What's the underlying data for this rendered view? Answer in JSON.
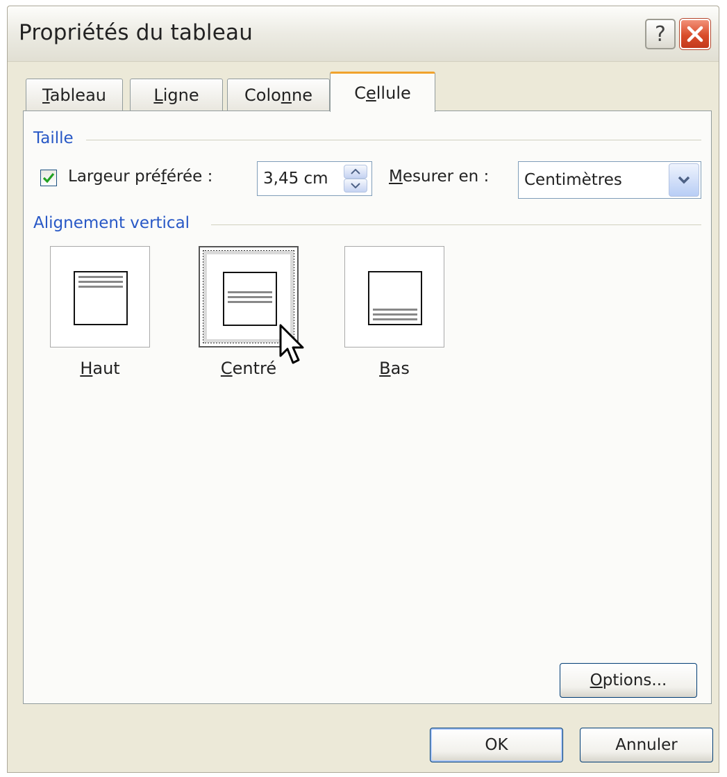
{
  "dialog": {
    "title": "Propriétés du tableau",
    "help_symbol": "?",
    "close_icon": "close-icon"
  },
  "tabs": [
    {
      "pre": "",
      "u": "T",
      "post": "ableau",
      "active": false
    },
    {
      "pre": "",
      "u": "L",
      "post": "igne",
      "active": false
    },
    {
      "pre": "Colo",
      "u": "n",
      "post": "ne",
      "active": false
    },
    {
      "pre": "C",
      "u": "e",
      "post": "llule",
      "active": true
    }
  ],
  "size_section": {
    "label": "Taille",
    "preferred_width": {
      "checked": true,
      "label_pre": "Largeur pré",
      "label_u": "f",
      "label_post": "érée :",
      "value": "3,45 cm"
    },
    "measure_in": {
      "label_u": "M",
      "label_post": "esurer en :",
      "selected": "Centimètres"
    }
  },
  "vertical_alignment": {
    "label": "Alignement vertical",
    "options": [
      {
        "u": "H",
        "post": "aut",
        "position": "top",
        "selected": false
      },
      {
        "u": "C",
        "post": "entré",
        "position": "center",
        "selected": true
      },
      {
        "u": "B",
        "post": "as",
        "position": "bottom",
        "selected": false
      }
    ]
  },
  "buttons": {
    "options_u": "O",
    "options_post": "ptions...",
    "ok": "OK",
    "cancel": "Annuler"
  },
  "colors": {
    "section_label": "#2858c6",
    "active_tab_accent": "#f0a22c",
    "close_button": "#d94c2a",
    "checkbox_check": "#21a121"
  }
}
